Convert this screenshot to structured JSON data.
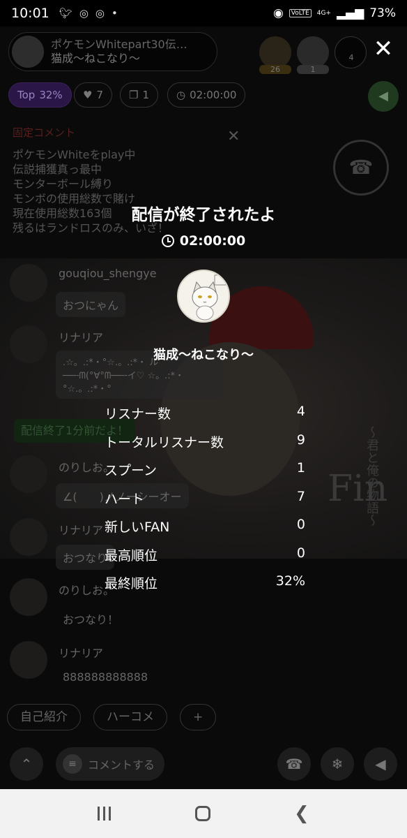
{
  "status_bar": {
    "time": "10:01",
    "battery": "73%",
    "volte": "VoLTE",
    "network": "4G+",
    "icons": [
      "twitter-icon",
      "chrome-icon",
      "chrome-icon",
      "dot-icon",
      "location-icon",
      "signal-icon",
      "battery-icon"
    ]
  },
  "live": {
    "title": "ポケモンWhitepart30伝…",
    "host": "猫成〜ねこなり〜",
    "top_rank_count": "26",
    "second_rank_count": "1",
    "listeners": "4"
  },
  "pills": {
    "top_label": "Top",
    "top_percent": "32%",
    "hearts": "7",
    "gifts": "1",
    "timer": "02:00:00"
  },
  "pinned": {
    "header": "固定コメント",
    "lines": [
      "ポケモンWhiteをplay中",
      "伝説捕獲真っ最中",
      "モンターボール縛り",
      "モンボの使用総数で賭け",
      "現在使用総数163個",
      "残るはランドロスのみ、いざ！"
    ]
  },
  "chat": [
    {
      "name": "gouqiou_shengye",
      "message": "おつにゃん"
    },
    {
      "name": "リナリア",
      "message": ".☆。.:*・°☆.。.:*・ ル──╌ᗰ(°∀°ᗰ──╌イ♡ ☆。.:*・°☆.。.:*・°"
    },
    {
      "name": "のりしお。",
      "message": "∠(　　)ノノーシーオー"
    },
    {
      "name": "リナリア",
      "message": "おつなり"
    },
    {
      "name": "のりしお。",
      "message": "おつなり！"
    },
    {
      "name": "リナリア",
      "message": "888888888888"
    }
  ],
  "notice": "配信終了1分前だよ！",
  "quick_replies": [
    "自己紹介",
    "ハーコメ",
    "+"
  ],
  "bottom": {
    "comment_placeholder": "コメントする"
  },
  "summary": {
    "title": "配信が終了されたよ",
    "duration": "02:00:00",
    "host_name": "猫成〜ねこなり〜",
    "stats": [
      {
        "label": "リスナー数",
        "value": "4"
      },
      {
        "label": "トータルリスナー数",
        "value": "9"
      },
      {
        "label": "スプーン",
        "value": "1"
      },
      {
        "label": "ハート",
        "value": "7"
      },
      {
        "label": "新しいFAN",
        "value": "0"
      },
      {
        "label": "最高順位",
        "value": "0"
      },
      {
        "label": "最終順位",
        "value": "32%"
      }
    ]
  },
  "background_art": {
    "fin": "Fin",
    "subtitle": "〜君と俺の物語〜"
  },
  "colors": {
    "accent_purple": "#2b1747",
    "notice_green": "#122412",
    "nav_bg": "#f2f2f2"
  }
}
